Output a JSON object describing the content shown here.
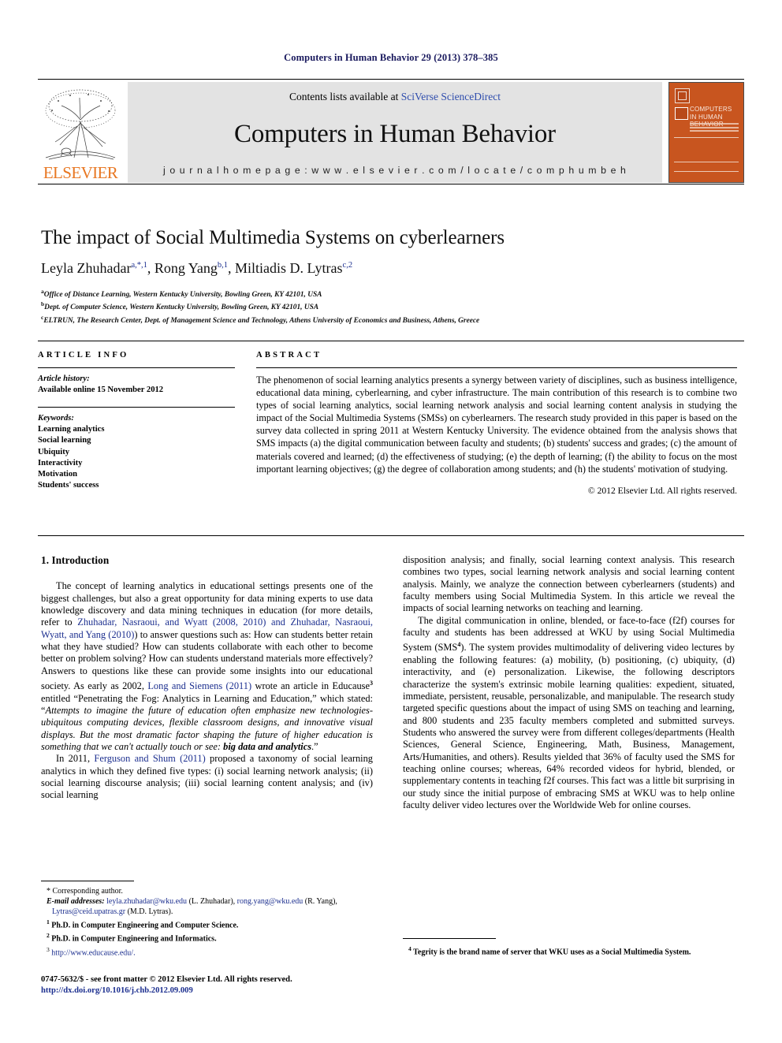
{
  "running_head": "Computers in Human Behavior 29 (2013) 378–385",
  "masthead": {
    "publisher_name": "ELSEVIER",
    "contents_prefix": "Contents lists available at ",
    "contents_link": "SciVerse ScienceDirect",
    "journal_name": "Computers in Human Behavior",
    "homepage": "j o u r n a l   h o m e p a g e :   w w w . e l s e v i e r . c o m / l o c a t e / c o m p h u m b e h",
    "cover_title": "COMPUTERS IN HUMAN BEHAVIOR"
  },
  "article": {
    "title": "The impact of Social Multimedia Systems on cyberlearners",
    "authors_html": "Leyla Zhuhadar<sup>a,*,1</sup>, Rong Yang<sup>b,1</sup>, Miltiadis D. Lytras<sup>c,2</sup>",
    "affiliations": [
      "Office of Distance Learning, Western Kentucky University, Bowling Green, KY 42101, USA",
      "Dept. of Computer Science, Western Kentucky University, Bowling Green, KY 42101, USA",
      "ELTRUN, The Research Center, Dept. of Management Science and Technology, Athens University of Economics and Business, Athens, Greece"
    ],
    "affiliation_marks": [
      "a",
      "b",
      "c"
    ]
  },
  "article_info": {
    "heading": "ARTICLE INFO",
    "history_label": "Article history:",
    "history_value": "Available online 15 November 2012",
    "keywords_label": "Keywords:",
    "keywords": [
      "Learning analytics",
      "Social learning",
      "Ubiquity",
      "Interactivity",
      "Motivation",
      "Students' success"
    ]
  },
  "abstract": {
    "heading": "ABSTRACT",
    "text": "The phenomenon of social learning analytics presents a synergy between variety of disciplines, such as business intelligence, educational data mining, cyberlearning, and cyber infrastructure. The main contribution of this research is to combine two types of social learning analytics, social learning network analysis and social learning content analysis in studying the impact of the Social Multimedia Systems (SMSs) on cyberlearners. The research study provided in this paper is based on the survey data collected in spring 2011 at Western Kentucky University. The evidence obtained from the analysis shows that SMS impacts (a) the digital communication between faculty and students; (b) students' success and grades; (c) the amount of materials covered and learned; (d) the effectiveness of studying; (e) the depth of learning; (f) the ability to focus on the most important learning objectives; (g) the degree of collaboration among students; and (h) the students' motivation of studying.",
    "copyright": "© 2012 Elsevier Ltd. All rights reserved."
  },
  "body": {
    "section_heading": "1. Introduction",
    "left_paragraph_1_part1": "The concept of learning analytics in educational settings presents one of the biggest challenges, but also a great opportunity for data mining experts to use data knowledge discovery and data mining techniques in education (for more details, refer to ",
    "left_ref_1": "Zhuhadar, Nasraoui, and Wyatt (2008, 2010) and Zhuhadar, Nasraoui, Wyatt, and Yang (2010)",
    "left_paragraph_1_part2": ") to answer questions such as: How can students better retain what they have studied? How can students collaborate with each other to become better on problem solving? How can students understand materials more effectively? Answers to questions like these can provide some insights into our educational society. As early as 2002, ",
    "left_ref_2": "Long and Siemens (2011)",
    "left_paragraph_1_part3": " wrote an article in Educause",
    "left_footnote_mark_3": "3",
    "left_paragraph_1_part4": " entitled “Penetrating the Fog: Analytics in Learning and Education,” which stated: “",
    "left_quote_italic": "Attempts to imagine the future of education often emphasize new technologies-ubiquitous computing devices, flexible classroom designs, and innovative visual displays. But the most dramatic factor shaping the future of higher education is something that we can't actually touch or see: ",
    "left_quote_bold": "big data and analytics",
    "left_quote_end": ".”",
    "left_paragraph_2_part1": "In 2011, ",
    "left_ref_3": "Ferguson and Shum (2011)",
    "left_paragraph_2_part2": " proposed a taxonomy of social learning analytics in which they defined five types: (i) social learning network analysis; (ii) social learning discourse analysis; (iii) social learning content analysis; and (iv) social learning",
    "right_paragraph_1": "disposition analysis; and finally, social learning context analysis. This research combines two types, social learning network analysis and social learning content analysis. Mainly, we analyze the connection between cyberlearners (students) and faculty members using Social Multimedia System. In this article we reveal the impacts of social learning networks on teaching and learning.",
    "right_paragraph_2_part1": "The digital communication in online, blended, or face-to-face (f2f) courses for faculty and students has been addressed at WKU by using Social Multimedia System (SMS",
    "right_footnote_mark_4": "4",
    "right_paragraph_2_part2": "). The system provides multimodality of delivering video lectures by enabling the following features: (a) mobility, (b) positioning, (c) ubiquity, (d) interactivity, and (e) personalization. Likewise, the following descriptors characterize the system's extrinsic mobile learning qualities: expedient, situated, immediate, persistent, reusable, personalizable, and manipulable. The research study targeted specific questions about the impact of using SMS on teaching and learning, and 800 students and 235 faculty members completed and submitted surveys. Students who answered the survey were from different colleges/departments (Health Sciences, General Science, Engineering, Math, Business, Management, Arts/Humanities, and others). Results yielded that 36% of faculty used the SMS for teaching online courses; whereas, 64% recorded videos for hybrid, blended, or supplementary contents in teaching f2f courses. This fact was a little bit surprising in our study since the initial purpose of embracing SMS at WKU was to help online faculty deliver video lectures over the Worldwide Web for online courses."
  },
  "footnotes": {
    "corresponding": "* Corresponding author.",
    "email_label": "E-mail addresses:",
    "email_1": "leyla.zhuhadar@wku.edu",
    "email_1_owner": " (L. Zhuhadar), ",
    "email_2": "rong.yang@wku.edu",
    "email_2_owner": " (R. Yang), ",
    "email_3": "Lytras@ceid.upatras.gr",
    "email_3_owner": " (M.D. Lytras).",
    "note_1_mark": "1",
    "note_1": "Ph.D. in Computer Engineering and Computer Science.",
    "note_2_mark": "2",
    "note_2": "Ph.D. in Computer Engineering and Informatics.",
    "note_3_mark": "3",
    "note_3": "http://www.educause.edu/.",
    "note_4_mark": "4",
    "note_4": "Tegrity is the brand name of server that WKU uses as a Social Multimedia System."
  },
  "imprint": {
    "issn_line": "0747-5632/$ - see front matter © 2012 Elsevier Ltd. All rights reserved.",
    "doi_line": "http://dx.doi.org/10.1016/j.chb.2012.09.009"
  },
  "colors": {
    "link": "#1c2f8f",
    "elsevier_orange": "#E87722",
    "cover_orange": "#c8551f",
    "band_grey": "#e3e3e3"
  }
}
